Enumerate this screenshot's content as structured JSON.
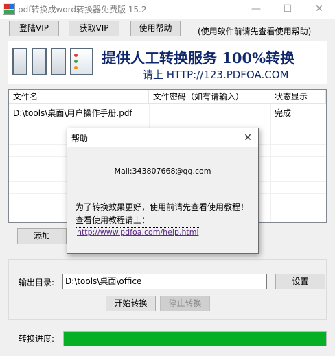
{
  "window": {
    "title": "pdf转换成word转换器免费版 15.2",
    "minimize_glyph": "—",
    "maximize_glyph": "☐",
    "close_glyph": "✕"
  },
  "toolbar": {
    "login_vip": "登陆VIP",
    "get_vip": "获取VIP",
    "help": "使用帮助",
    "note": "(使用软件前请先查看使用帮助)"
  },
  "banner": {
    "headline": "提供人工转换服务 100%转换",
    "subline": "请上  HTTP://123.PDFOA.COM"
  },
  "file_list": {
    "columns": [
      "文件名",
      "文件密码（如有请输入）",
      "状态显示"
    ],
    "rows": [
      {
        "name": "D:\\tools\\桌面\\用户操作手册.pdf",
        "password": "",
        "status": "完成"
      }
    ]
  },
  "actions": {
    "add": "添加"
  },
  "output": {
    "label": "输出目录:",
    "path": "D:\\tools\\桌面\\office",
    "settings": "设置",
    "start": "开始转换",
    "stop": "停止转换"
  },
  "progress": {
    "label": "转换进度:",
    "value": 1.0,
    "color": "#06b025"
  },
  "help_dialog": {
    "title": "帮助",
    "close_glyph": "✕",
    "mail": "Mail:343807668@qq.com",
    "tip_line1": "为了转换效果更好，使用前请先查看使用教程！",
    "tip_line2": "查看使用教程请上：",
    "link": "http://www.pdfoa.com/help.html"
  }
}
